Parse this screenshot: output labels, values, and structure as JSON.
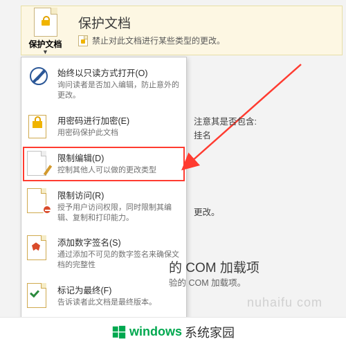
{
  "banner": {
    "button_label": "保护文档",
    "title": "保护文档",
    "subtitle": "禁止对此文档进行某些类型的更改。"
  },
  "menu": {
    "items": [
      {
        "title": "始终以只读方式打开(O)",
        "desc": "询问读者是否加入编辑，防止意外的更改。"
      },
      {
        "title": "用密码进行加密(E)",
        "desc": "用密码保护此文档"
      },
      {
        "title": "限制编辑(D)",
        "desc": "控制其他人可以做的更改类型"
      },
      {
        "title": "限制访问(R)",
        "desc": "授予用户访问权限，同时限制其编辑、复制和打印能力。"
      },
      {
        "title": "添加数字签名(S)",
        "desc": "通过添加不可见的数字签名来确保文档的完整性"
      },
      {
        "title": "标记为最终(F)",
        "desc": "告诉读者此文档是最终版本。"
      }
    ]
  },
  "background": {
    "text1": "注意其是否包含:",
    "text2": "挂名",
    "text3": "更改。",
    "com_title": "的 COM 加载项",
    "com_sub": "验的 COM 加载项。"
  },
  "footer": {
    "brand_left": "windows",
    "brand_right": "系统家园"
  },
  "watermark": "nuhaifu com"
}
